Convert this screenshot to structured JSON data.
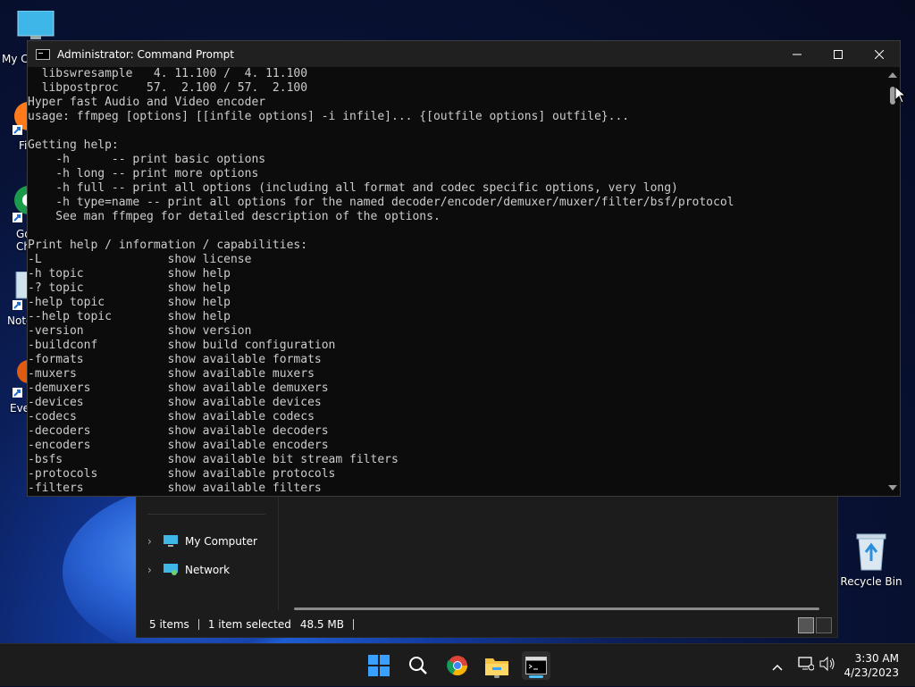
{
  "desktop": {
    "icons": {
      "my_computer_partial": "My C",
      "firefox_partial": "Fi",
      "chrome_partial_1": "Go",
      "chrome_partial_2": "Ch",
      "notepad_partial": "Note",
      "everything_partial": "Eve",
      "recycle_bin": "Recycle Bin"
    }
  },
  "explorer": {
    "nav": [
      {
        "label": "My Computer",
        "icon": "computer-icon"
      },
      {
        "label": "Network",
        "icon": "network-icon"
      }
    ],
    "status": {
      "items": "5 items",
      "selected": "1 item selected",
      "size": "48.5 MB"
    }
  },
  "cmd": {
    "title": "Administrator: Command Prompt",
    "lines": [
      "  libswresample   4. 11.100 /  4. 11.100",
      "  libpostproc    57.  2.100 / 57.  2.100",
      "Hyper fast Audio and Video encoder",
      "usage: ffmpeg [options] [[infile options] -i infile]... {[outfile options] outfile}...",
      "",
      "Getting help:",
      "    -h      -- print basic options",
      "    -h long -- print more options",
      "    -h full -- print all options (including all format and codec specific options, very long)",
      "    -h type=name -- print all options for the named decoder/encoder/demuxer/muxer/filter/bsf/protocol",
      "    See man ffmpeg for detailed description of the options.",
      "",
      "Print help / information / capabilities:",
      "-L                  show license",
      "-h topic            show help",
      "-? topic            show help",
      "-help topic         show help",
      "--help topic        show help",
      "-version            show version",
      "-buildconf          show build configuration",
      "-formats            show available formats",
      "-muxers             show available muxers",
      "-demuxers           show available demuxers",
      "-devices            show available devices",
      "-codecs             show available codecs",
      "-decoders           show available decoders",
      "-encoders           show available encoders",
      "-bsfs               show available bit stream filters",
      "-protocols          show available protocols",
      "-filters            show available filters"
    ]
  },
  "taskbar": {
    "apps": [
      "start-icon",
      "search-icon",
      "chrome-icon",
      "file-explorer-icon",
      "command-prompt-icon"
    ],
    "clock": {
      "time": "3:30 AM",
      "date": "4/23/2023"
    }
  }
}
